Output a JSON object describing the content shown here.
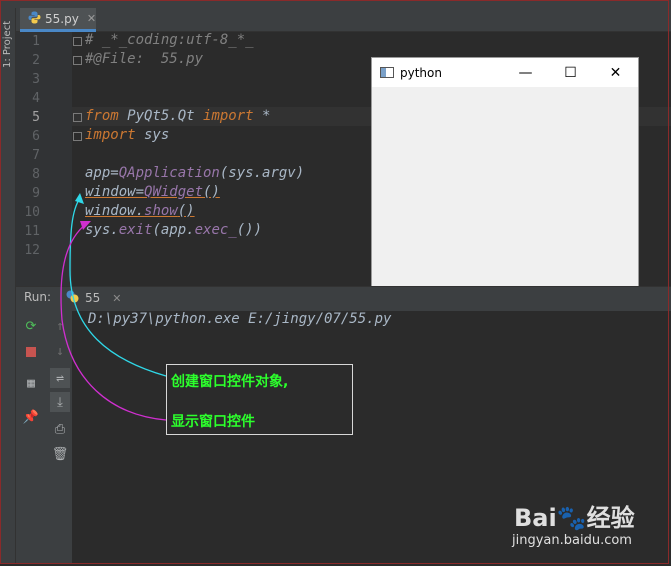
{
  "sidebar": {
    "project_label": "1: Project"
  },
  "editor": {
    "tab": {
      "filename": "55.py",
      "close": "✕"
    },
    "line_numbers": [
      "1",
      "2",
      "3",
      "4",
      "5",
      "6",
      "7",
      "8",
      "9",
      "10",
      "11",
      "12"
    ],
    "lines": {
      "l1": "# _*_coding:utf-8_*_",
      "l2": "#@File:  55.py",
      "l5_from": "from",
      "l5_mod": " PyQt5.Qt ",
      "l5_import": "import",
      "l5_star": " *",
      "l6_import": "import",
      "l6_mod": " sys",
      "l8_var": "app=",
      "l8_cls": "QApplication",
      "l8_args": "(sys.argv)",
      "l9_var": "window=",
      "l9_cls": "QWidget",
      "l9_args": "()",
      "l10_var": "window.",
      "l10_fn": "show",
      "l10_args": "()",
      "l11_mod": "sys.",
      "l11_fn": "exit",
      "l11_a": "(app.",
      "l11_fn2": "exec_",
      "l11_b": "())"
    }
  },
  "python_window": {
    "title": "python",
    "minimize": "—",
    "maximize": "☐",
    "close": "✕"
  },
  "run_panel": {
    "label": "Run:",
    "tab_name": "55",
    "tab_close": "✕",
    "output": "D:\\py37\\python.exe E:/jingy/07/55.py"
  },
  "annotation": {
    "line1": "创建窗口控件对象,",
    "line2": "显示窗口控件",
    "arrow1_color": "#2fd8e8",
    "arrow2_color": "#d02fd0",
    "text_color": "#2cff2c"
  },
  "watermark": {
    "logo": "Bai🐾经验",
    "url": "jingyan.baidu.com"
  },
  "colors": {
    "editor_bg": "#2b2b2b",
    "keyword": "#cc7832",
    "identifier": "#a9b7c6",
    "function": "#9876aa",
    "comment": "#808080"
  }
}
